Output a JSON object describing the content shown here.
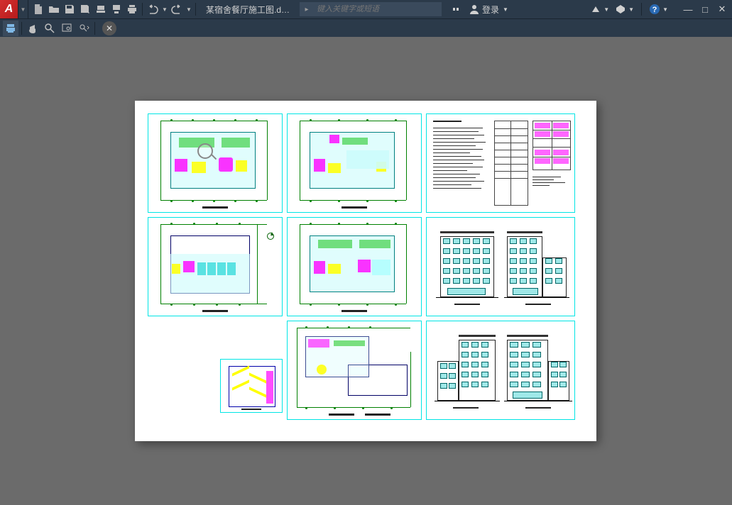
{
  "app": {
    "letter": "A"
  },
  "document": {
    "title": "某宿舍餐厅施工图.d…"
  },
  "search": {
    "placeholder": "键入关键字或短语"
  },
  "login": {
    "label": "登录"
  },
  "colors": {
    "cyan": "#00e5e5",
    "magenta": "#ff00ff",
    "green": "#008000",
    "yellow": "#ffff00"
  }
}
